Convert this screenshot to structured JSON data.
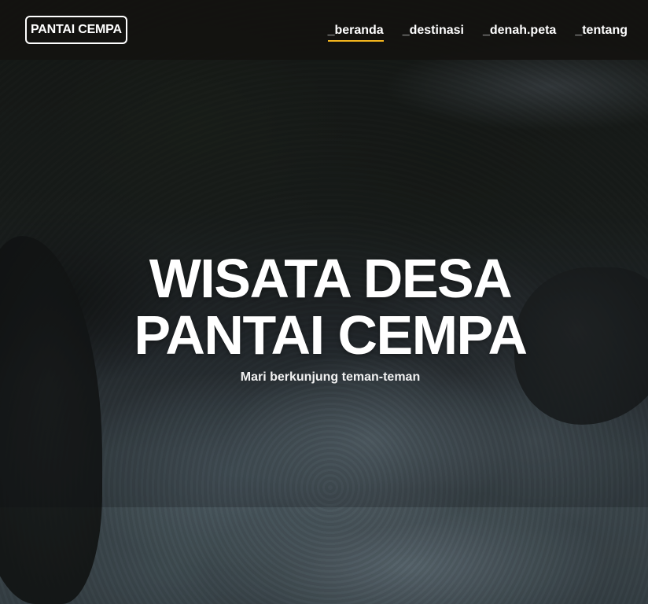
{
  "header": {
    "logo": "PANTAI CEMPA",
    "nav": [
      {
        "label": "_beranda",
        "active": true
      },
      {
        "label": "_destinasi",
        "active": false
      },
      {
        "label": "_denah.peta",
        "active": false
      },
      {
        "label": "_tentang",
        "active": false
      }
    ],
    "accent_color": "#f3b51d"
  },
  "hero": {
    "title_line_1": "WISATA DESA",
    "title_line_2": "PANTAI CEMPA",
    "subtitle": "Mari berkunjung teman-teman",
    "background": "waterfall-photo"
  }
}
